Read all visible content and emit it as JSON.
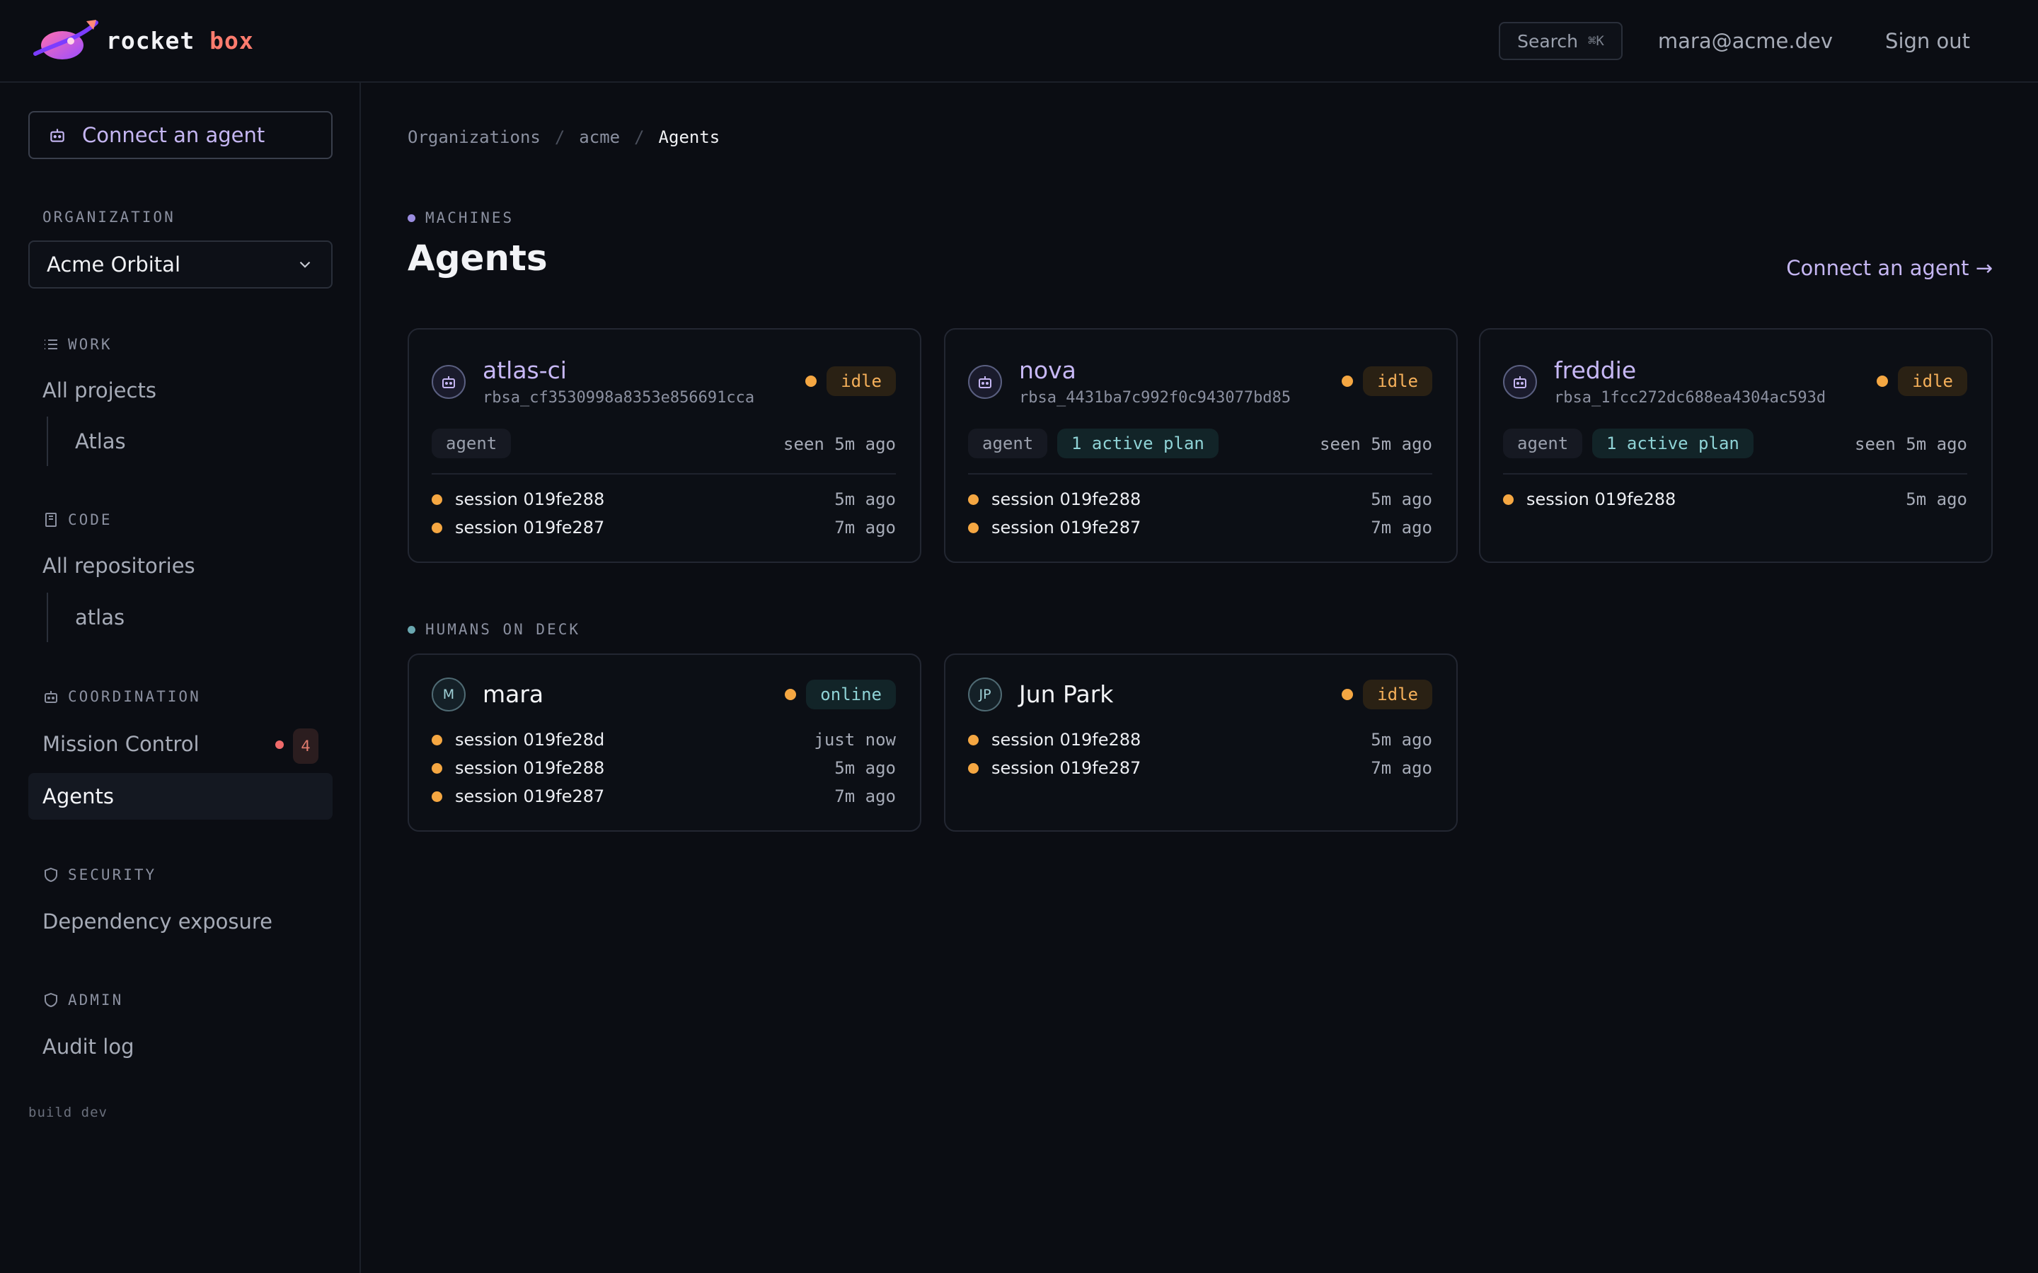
{
  "app": {
    "logo_word1": "rocket",
    "logo_word2": "box"
  },
  "header": {
    "search_label": "Search",
    "search_shortcut": "⌘K",
    "user_email": "mara@acme.dev",
    "sign_out": "Sign out"
  },
  "sidebar": {
    "connect_label": "Connect an agent",
    "org_section": "ORGANIZATION",
    "org_selected": "Acme Orbital",
    "work_section": "WORK",
    "all_projects": "All projects",
    "project_atlas": "Atlas",
    "code_section": "CODE",
    "all_repositories": "All repositories",
    "repo_atlas": "atlas",
    "coordination_section": "COORDINATION",
    "mission_control": "Mission Control",
    "mission_control_count": "4",
    "agents": "Agents",
    "security_section": "SECURITY",
    "dependency_exposure": "Dependency exposure",
    "admin_section": "ADMIN",
    "audit_log": "Audit log",
    "build": "build dev"
  },
  "breadcrumb": {
    "org": "Organizations",
    "acme": "acme",
    "current": "Agents"
  },
  "main": {
    "machines_eyebrow": "MACHINES",
    "title": "Agents",
    "connect_link": "Connect an agent →",
    "humans_eyebrow": "HUMANS ON DECK"
  },
  "agents": [
    {
      "name": "atlas-ci",
      "id": "rbsa_cf3530998a8353e856691cca",
      "status": "idle",
      "tag": "agent",
      "plan": "",
      "seen": "seen 5m ago",
      "sessions": [
        {
          "name": "session 019fe288",
          "time": "5m ago"
        },
        {
          "name": "session 019fe287",
          "time": "7m ago"
        }
      ]
    },
    {
      "name": "nova",
      "id": "rbsa_4431ba7c992f0c943077bd85",
      "status": "idle",
      "tag": "agent",
      "plan": "1 active plan",
      "seen": "seen 5m ago",
      "sessions": [
        {
          "name": "session 019fe288",
          "time": "5m ago"
        },
        {
          "name": "session 019fe287",
          "time": "7m ago"
        }
      ]
    },
    {
      "name": "freddie",
      "id": "rbsa_1fcc272dc688ea4304ac593d",
      "status": "idle",
      "tag": "agent",
      "plan": "1 active plan",
      "seen": "seen 5m ago",
      "sessions": [
        {
          "name": "session 019fe288",
          "time": "5m ago"
        }
      ]
    }
  ],
  "humans": [
    {
      "initials": "M",
      "name": "mara",
      "status": "online",
      "sessions": [
        {
          "name": "session 019fe28d",
          "time": "just now"
        },
        {
          "name": "session 019fe288",
          "time": "5m ago"
        },
        {
          "name": "session 019fe287",
          "time": "7m ago"
        }
      ]
    },
    {
      "initials": "JP",
      "name": "Jun Park",
      "status": "idle",
      "sessions": [
        {
          "name": "session 019fe288",
          "time": "5m ago"
        },
        {
          "name": "session 019fe287",
          "time": "7m ago"
        }
      ]
    }
  ],
  "colors": {
    "background": "#0b0d13",
    "accent": "#c5b6f2",
    "brand_coral": "#ff7c6e",
    "idle": "#f5a742",
    "online": "#8fd3d6",
    "alert": "#ef6a6a"
  },
  "icons": {
    "logo": "rocket-planet-icon",
    "connect": "robot-icon",
    "work": "list-icon",
    "code": "book-icon",
    "coordination": "robot-icon",
    "security": "shield-icon",
    "admin": "shield-icon",
    "org_select": "chevron-down-icon"
  }
}
